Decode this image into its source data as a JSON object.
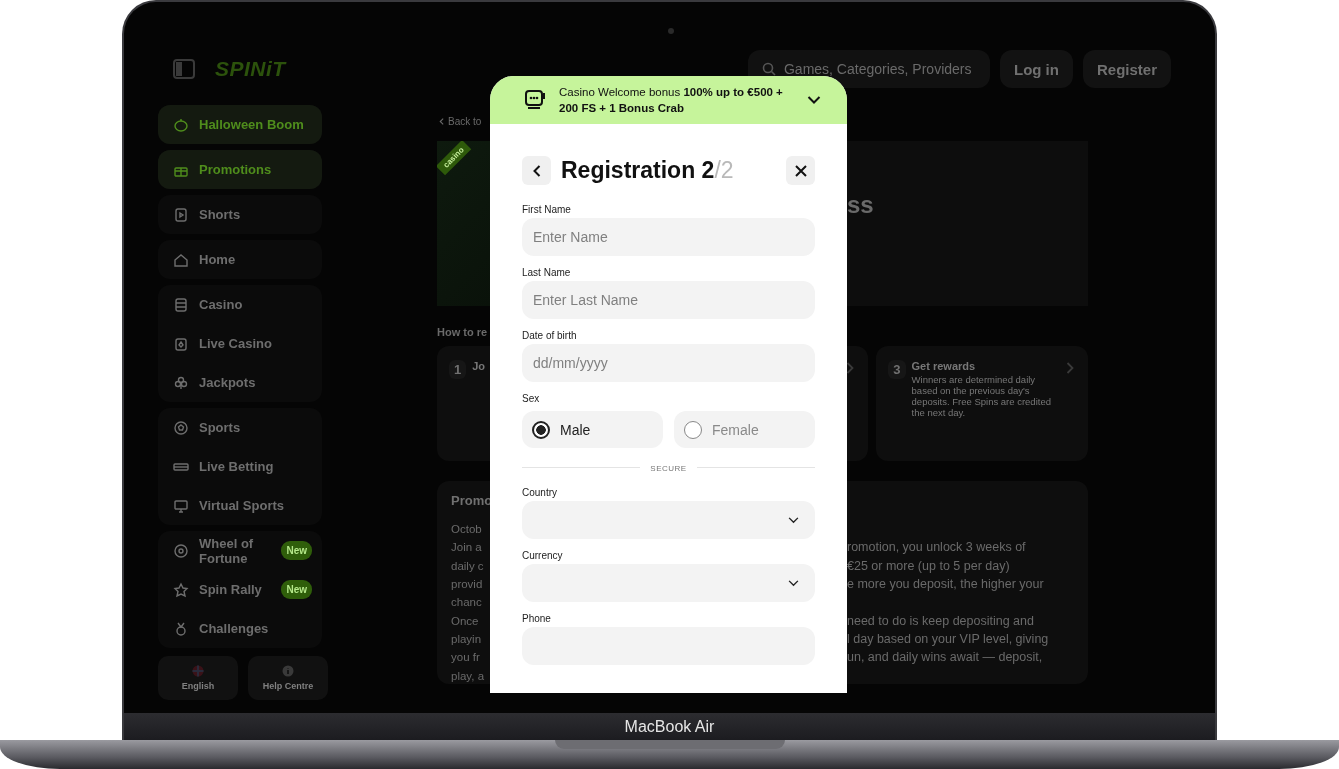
{
  "device": {
    "label": "MacBook Air"
  },
  "site": {
    "logo": "SPINiT",
    "search": {
      "placeholder": "Games, Categories, Providers"
    },
    "header_buttons": [
      {
        "label": "Log in"
      },
      {
        "label": "Register"
      }
    ]
  },
  "sidebar": {
    "groups": [
      {
        "items": [
          {
            "label": "Halloween Boom",
            "kind": "featured"
          }
        ]
      },
      {
        "items": [
          {
            "label": "Promotions",
            "kind": "featured"
          }
        ]
      },
      {
        "items": [
          {
            "label": "Shorts",
            "kind": "regular"
          }
        ]
      },
      {
        "items": [
          {
            "label": "Home",
            "kind": "regular"
          }
        ]
      },
      {
        "items": [
          {
            "label": "Casino",
            "kind": "regular"
          },
          {
            "label": "Live Casino",
            "kind": "regular"
          },
          {
            "label": "Jackpots",
            "kind": "regular"
          }
        ]
      },
      {
        "items": [
          {
            "label": "Sports",
            "kind": "regular"
          },
          {
            "label": "Live Betting",
            "kind": "regular"
          },
          {
            "label": "Virtual Sports",
            "kind": "regular"
          }
        ]
      },
      {
        "items": [
          {
            "label": "Wheel of Fortune",
            "kind": "regular",
            "badge": "New"
          },
          {
            "label": "Spin Rally",
            "kind": "regular",
            "badge": "New"
          },
          {
            "label": "Challenges",
            "kind": "regular"
          }
        ]
      }
    ],
    "footer": [
      {
        "label": "English"
      },
      {
        "label": "Help Centre"
      }
    ]
  },
  "main": {
    "back_link": "Back to",
    "banner": {
      "ribbon": "casino",
      "title_fragment": "ss"
    },
    "steps_heading": "How to re",
    "steps": [
      {
        "kind": "full",
        "number": "1",
        "title": "Jo"
      },
      {
        "kind": "covered"
      },
      {
        "kind": "full",
        "number": "3",
        "title": "Get rewards",
        "text": "Winners are determined daily based on the previous day's deposits. Free Spins are credited the next day."
      }
    ],
    "promo": {
      "title": "Promo",
      "lines": [
        {
          "left": "Octob"
        },
        {
          "left": "Join a",
          "right": "romotion, you unlock 3 weeks of"
        },
        {
          "left": "daily c",
          "right": "€25 or more (up to 5 per day)"
        },
        {
          "left": "provid",
          "right": "e more you deposit, the higher your"
        },
        {
          "left": "chanc"
        },
        {
          "left": "Once",
          "right": "need to do is keep depositing and"
        },
        {
          "left": "playin",
          "right": "l day based on your VIP level, giving"
        },
        {
          "left": "you fr",
          "right": "un, and daily wins await — deposit,"
        },
        {
          "left": "play, a"
        }
      ]
    }
  },
  "modal": {
    "promo": {
      "text": "Casino Welcome bonus **100% up to €500 + 200 FS + 1 Bonus Crab**",
      "expanded": false
    },
    "title": "Registration 2",
    "title_total": "/2",
    "fields": [
      {
        "kind": "text",
        "label": "First Name",
        "placeholder": "Enter Name"
      },
      {
        "kind": "text",
        "label": "Last Name",
        "placeholder": "Enter Last Name"
      },
      {
        "kind": "text",
        "label": "Date of birth",
        "placeholder": "dd/mm/yyyy"
      },
      {
        "kind": "radio",
        "label": "Sex",
        "options": [
          {
            "label": "Male",
            "selected": true
          },
          {
            "label": "Female",
            "selected": false
          }
        ]
      },
      {
        "kind": "divider",
        "label": "SECURE"
      },
      {
        "kind": "select",
        "label": "Country"
      },
      {
        "kind": "select",
        "label": "Currency"
      },
      {
        "kind": "text",
        "label": "Phone"
      }
    ]
  }
}
